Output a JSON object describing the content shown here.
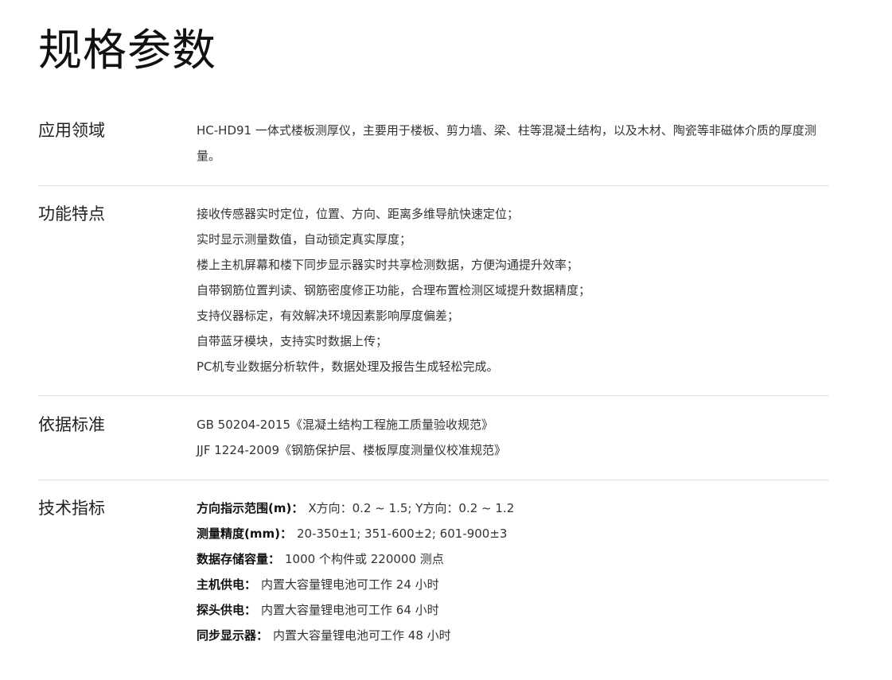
{
  "title": "规格参数",
  "sections": {
    "application": {
      "label": "应用领域",
      "text": "HC-HD91 一体式楼板测厚仪，主要用于楼板、剪力墙、梁、柱等混凝土结构，以及木材、陶瓷等非磁体介质的厚度测量。"
    },
    "features": {
      "label": "功能特点",
      "items": [
        "接收传感器实时定位，位置、方向、距离多维导航快速定位；",
        "实时显示测量数值，自动锁定真实厚度；",
        "楼上主机屏幕和楼下同步显示器实时共享检测数据，方便沟通提升效率；",
        "自带钢筋位置判读、钢筋密度修正功能，合理布置检测区域提升数据精度；",
        "支持仪器标定，有效解决环境因素影响厚度偏差；",
        "自带蓝牙模块，支持实时数据上传；",
        "PC机专业数据分析软件，数据处理及报告生成轻松完成。"
      ]
    },
    "standards": {
      "label": "依据标准",
      "items": [
        "GB 50204-2015《混凝土结构工程施工质量验收规范》",
        "JJF 1224-2009《钢筋保护层、楼板厚度测量仪校准规范》"
      ]
    },
    "specs": {
      "label": "技术指标",
      "items": [
        {
          "key": "方向指示范围(m)：",
          "value": "X方向：0.2 ~ 1.5; Y方向：0.2 ~ 1.2"
        },
        {
          "key": "测量精度(mm)：",
          "value": "20-350±1; 351-600±2; 601-900±3"
        },
        {
          "key": "数据存储容量：",
          "value": "1000 个构件或 220000 测点"
        },
        {
          "key": "主机供电：",
          "value": "内置大容量锂电池可工作 24 小时"
        },
        {
          "key": "探头供电：",
          "value": "内置大容量锂电池可工作 64 小时"
        },
        {
          "key": "同步显示器：",
          "value": "内置大容量锂电池可工作 48 小时"
        }
      ]
    }
  }
}
